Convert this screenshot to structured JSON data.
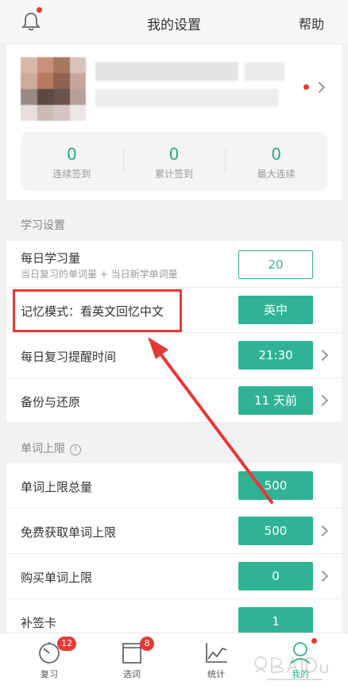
{
  "header": {
    "title": "我的设置",
    "help_label": "帮助",
    "bell_icon": "bell-icon"
  },
  "profile": {
    "avatar_icon": "pixelated-avatar",
    "stats": [
      {
        "value": "0",
        "label": "连续签到"
      },
      {
        "value": "0",
        "label": "累计签到"
      },
      {
        "value": "0",
        "label": "最大连续"
      }
    ]
  },
  "sections": {
    "learning": "学习设置",
    "word_limit": "单词上限"
  },
  "rows": {
    "daily_amount": {
      "title": "每日学习量",
      "subtitle": "当日复习的单词量 + 当日新学单词量",
      "value": "20"
    },
    "memory_mode": {
      "title": "记忆模式：看英文回忆中文",
      "value": "英中"
    },
    "reminder_time": {
      "title": "每日复习提醒时间",
      "value": "21:30"
    },
    "backup": {
      "title": "备份与还原",
      "value": "11 天前"
    },
    "limit_total": {
      "title": "单词上限总量",
      "value": "500"
    },
    "free_limit": {
      "title": "免费获取单词上限",
      "value": "500"
    },
    "buy_limit": {
      "title": "购买单词上限",
      "value": "0"
    },
    "makeup_card": {
      "title": "补签卡",
      "value": "1"
    }
  },
  "tabbar": {
    "tabs": [
      {
        "label": "复习",
        "badge": "12",
        "icon": "stopwatch-icon"
      },
      {
        "label": "选词",
        "badge": "8",
        "icon": "book-icon"
      },
      {
        "label": "统计",
        "icon": "chart-icon"
      },
      {
        "label": "我的",
        "icon": "person-icon"
      }
    ]
  },
  "colors": {
    "accent": "#2fb394",
    "stat_number": "#26a88e",
    "annotation_red": "#e53935",
    "badge": "#e53935"
  }
}
